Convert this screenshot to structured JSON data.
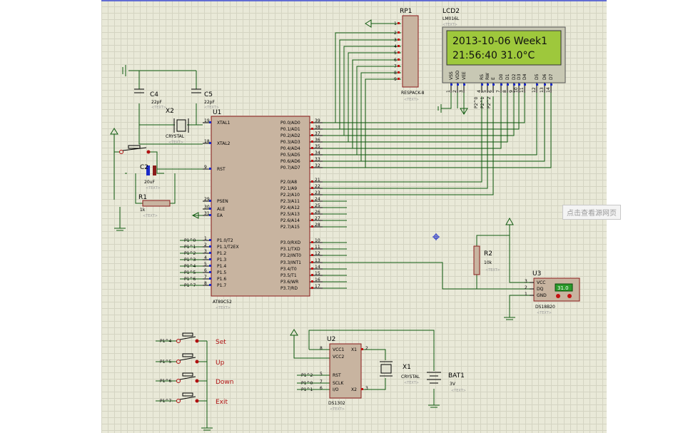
{
  "u1": {
    "ref": "U1",
    "part": "AT89C52",
    "text": "<TEXT>",
    "left_pins": [
      {
        "num": "19",
        "name": "XTAL1"
      },
      {
        "num": "18",
        "name": "XTAL2"
      },
      {
        "num": "9",
        "name": "RST"
      },
      {
        "num": "29",
        "name": "PSEN"
      },
      {
        "num": "30",
        "name": "ALE"
      },
      {
        "num": "31",
        "name": "EA"
      },
      {
        "num": "1",
        "name": "P1.0/T2",
        "net": "P1^0"
      },
      {
        "num": "2",
        "name": "P1.1/T2EX",
        "net": "P1^1"
      },
      {
        "num": "3",
        "name": "P1.2",
        "net": "P1^2"
      },
      {
        "num": "4",
        "name": "P1.3",
        "net": "P1^3"
      },
      {
        "num": "5",
        "name": "P1.4",
        "net": "P1^4"
      },
      {
        "num": "6",
        "name": "P1.5",
        "net": "P1^5"
      },
      {
        "num": "7",
        "name": "P1.6",
        "net": "P1^6"
      },
      {
        "num": "8",
        "name": "P1.7",
        "net": "P1^7"
      }
    ],
    "right_pins": [
      {
        "num": "39",
        "name": "P0.0/AD0"
      },
      {
        "num": "38",
        "name": "P0.1/AD1"
      },
      {
        "num": "37",
        "name": "P0.2/AD2"
      },
      {
        "num": "36",
        "name": "P0.3/AD3"
      },
      {
        "num": "35",
        "name": "P0.4/AD4"
      },
      {
        "num": "34",
        "name": "P0.5/AD5"
      },
      {
        "num": "33",
        "name": "P0.6/AD6"
      },
      {
        "num": "32",
        "name": "P0.7/AD7"
      },
      {
        "num": "21",
        "name": "P2.0/A8"
      },
      {
        "num": "22",
        "name": "P2.1/A9"
      },
      {
        "num": "23",
        "name": "P2.2/A10"
      },
      {
        "num": "24",
        "name": "P2.3/A11"
      },
      {
        "num": "25",
        "name": "P2.4/A12"
      },
      {
        "num": "26",
        "name": "P2.5/A13"
      },
      {
        "num": "27",
        "name": "P2.6/A14"
      },
      {
        "num": "28",
        "name": "P2.7/A15"
      },
      {
        "num": "10",
        "name": "P3.0/RXD"
      },
      {
        "num": "11",
        "name": "P3.1/TXD"
      },
      {
        "num": "12",
        "name": "P3.2/INT0"
      },
      {
        "num": "13",
        "name": "P3.3/INT1"
      },
      {
        "num": "14",
        "name": "P3.4/T0"
      },
      {
        "num": "15",
        "name": "P3.5/T1"
      },
      {
        "num": "16",
        "name": "P3.6/WR"
      },
      {
        "num": "17",
        "name": "P3.7/RD"
      }
    ]
  },
  "lcd": {
    "ref": "LCD2",
    "part": "LM016L",
    "text": "<TEXT>",
    "line1": "2013-10-06 Week1",
    "line2": "21:56:40  31.0°C",
    "pins": [
      "VSS",
      "VDD",
      "VEE",
      "RS",
      "RW",
      "E",
      "D0",
      "D1",
      "D2",
      "D3",
      "D4",
      "D5",
      "D6",
      "D7"
    ],
    "pin_nums": [
      "1",
      "2",
      "3",
      "4",
      "5",
      "6",
      "7",
      "8",
      "9",
      "10",
      "11",
      "12",
      "13",
      "14"
    ],
    "nets": [
      "P2^0",
      "P2^1",
      "P2^2"
    ]
  },
  "rp1": {
    "ref": "RP1",
    "part": "RESPACK-8",
    "text": "<TEXT>",
    "pins": [
      "1",
      "2",
      "3",
      "4",
      "5",
      "6",
      "7",
      "8",
      "9"
    ]
  },
  "c4": {
    "ref": "C4",
    "value": "22pF",
    "text": "<TEXT>"
  },
  "c5": {
    "ref": "C5",
    "value": "22pF",
    "text": "<TEXT>"
  },
  "x2": {
    "ref": "X2",
    "part": "CRYSTAL",
    "text": "<TEXT>"
  },
  "c2": {
    "ref": "C2",
    "value": "20uF",
    "text": "<TEXT>"
  },
  "r1": {
    "ref": "R1",
    "value": "1k",
    "text": "<TEXT>"
  },
  "r2": {
    "ref": "R2",
    "value": "10k",
    "text": "<TEXT>"
  },
  "u3": {
    "ref": "U3",
    "part": "DS18B20",
    "text": "<TEXT>",
    "display": "31.0",
    "pins": [
      {
        "num": "3",
        "name": "VCC"
      },
      {
        "num": "2",
        "name": "DQ"
      },
      {
        "num": "1",
        "name": "GND"
      }
    ]
  },
  "u2": {
    "ref": "U2",
    "part": "DS1302",
    "text": "<TEXT>",
    "left_pins": [
      {
        "num": "8",
        "name": "VCC1"
      },
      {
        "num": "",
        "name": "VCC2"
      },
      {
        "num": "5",
        "name": "RST",
        "net": "P1^2"
      },
      {
        "num": "7",
        "name": "SCLK",
        "net": "P1^0"
      },
      {
        "num": "6",
        "name": "I/O",
        "net": "P1^1"
      }
    ],
    "right_pins": [
      {
        "num": "2",
        "name": "X1"
      },
      {
        "num": "3",
        "name": "X2"
      }
    ]
  },
  "x1": {
    "ref": "X1",
    "part": "CRYSTAL",
    "text": "<TEXT>"
  },
  "bat1": {
    "ref": "BAT1",
    "value": "3V",
    "text": "<TEXT>"
  },
  "buttons": [
    {
      "net": "P1^4",
      "label": "Set"
    },
    {
      "net": "P1^5",
      "label": "Up"
    },
    {
      "net": "P1^6",
      "label": "Down"
    },
    {
      "net": "P1^7",
      "label": "Exit"
    }
  ],
  "overlay": {
    "badge": "点击查看源网页"
  },
  "colors": {
    "sheet": "#e9e9d8",
    "wire": "#0f5a0f",
    "body": "#c8b4a0",
    "pin_num": "#c41010",
    "lcd_bg": "#9ec83c"
  }
}
